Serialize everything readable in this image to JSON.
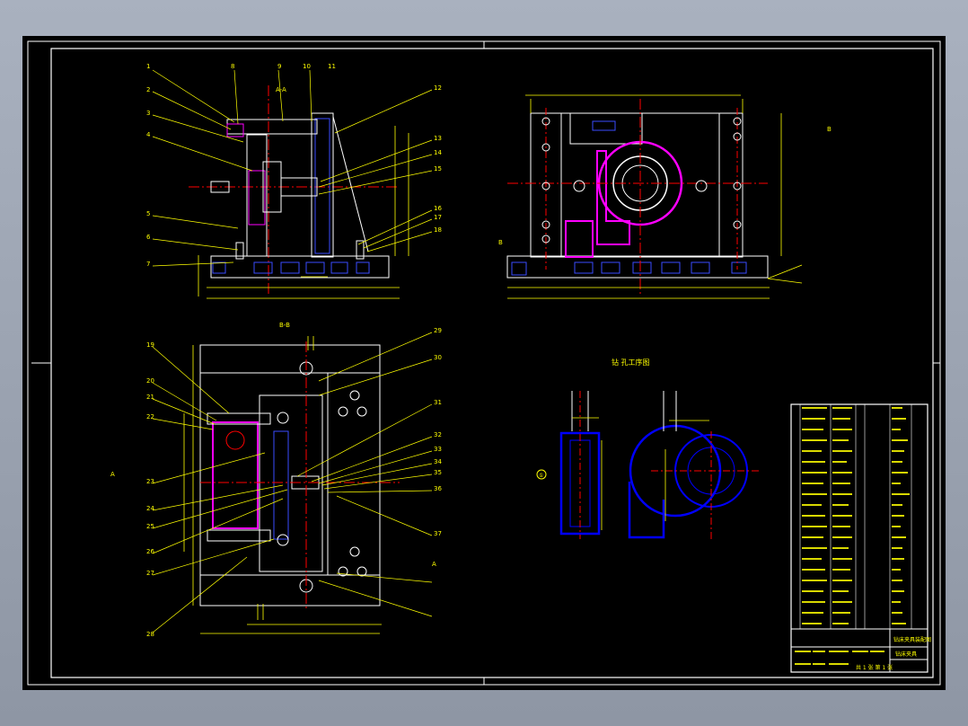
{
  "drawing": {
    "section_label_aa": "A-A",
    "section_label_bb": "B-B",
    "process_title": "钻 孔工序图",
    "view_marker_a": "A",
    "view_marker_b": "B",
    "circle_marker": "①"
  },
  "title_block": {
    "drawing_name_line1": "钻床夹具装配图",
    "drawing_name_line2": "钻床夹具",
    "scale_row": "共 1 张 第 1 张"
  },
  "balloons_top_left": [
    "1",
    "2",
    "3",
    "4",
    "5",
    "6",
    "7",
    "8",
    "9",
    "10",
    "11",
    "12",
    "13",
    "14",
    "15",
    "16",
    "17",
    "18"
  ],
  "balloons_bottom_left": [
    "19",
    "20",
    "21",
    "22",
    "23",
    "24",
    "25",
    "26",
    "27",
    "28",
    "29",
    "30",
    "31",
    "32",
    "33",
    "34",
    "35",
    "36",
    "37"
  ],
  "colors": {
    "background": "#000000",
    "outline": "#ffffff",
    "dimension": "#ffff00",
    "centerline": "#ff0000",
    "part": "#ff00ff",
    "workpiece": "#0000ff",
    "hatch": "#3a4bff"
  }
}
